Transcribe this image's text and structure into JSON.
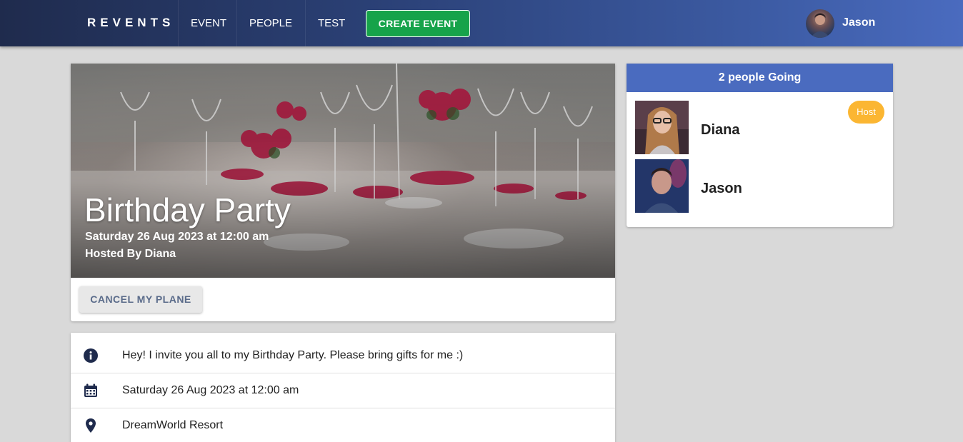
{
  "navbar": {
    "brand": "REVENTS",
    "items": [
      {
        "label": "EVENT"
      },
      {
        "label": "PEOPLE"
      },
      {
        "label": "TEST"
      }
    ],
    "create_label": "CREATE EVENT",
    "user_name": "Jason"
  },
  "event": {
    "title": "Birthday Party",
    "date": "Saturday 26 Aug 2023 at 12:00 am",
    "hosted_by": "Hosted By Diana",
    "cancel_label": "CANCEL MY PLANE",
    "details": [
      {
        "icon": "info-icon",
        "text": "Hey! I invite you all to my Birthday Party. Please bring gifts for me :)"
      },
      {
        "icon": "calendar-icon",
        "text": "Saturday 26 Aug 2023 at 12:00 am"
      },
      {
        "icon": "map-marker-icon",
        "text": "DreamWorld Resort"
      }
    ]
  },
  "attendees": {
    "header": "2 people Going",
    "list": [
      {
        "name": "Diana",
        "badge": "Host"
      },
      {
        "name": "Jason"
      }
    ]
  },
  "colors": {
    "accent": "#4a6bbf",
    "create_button": "#16a34a",
    "host_badge": "#fbb632",
    "icon": "#1f2b4d"
  }
}
